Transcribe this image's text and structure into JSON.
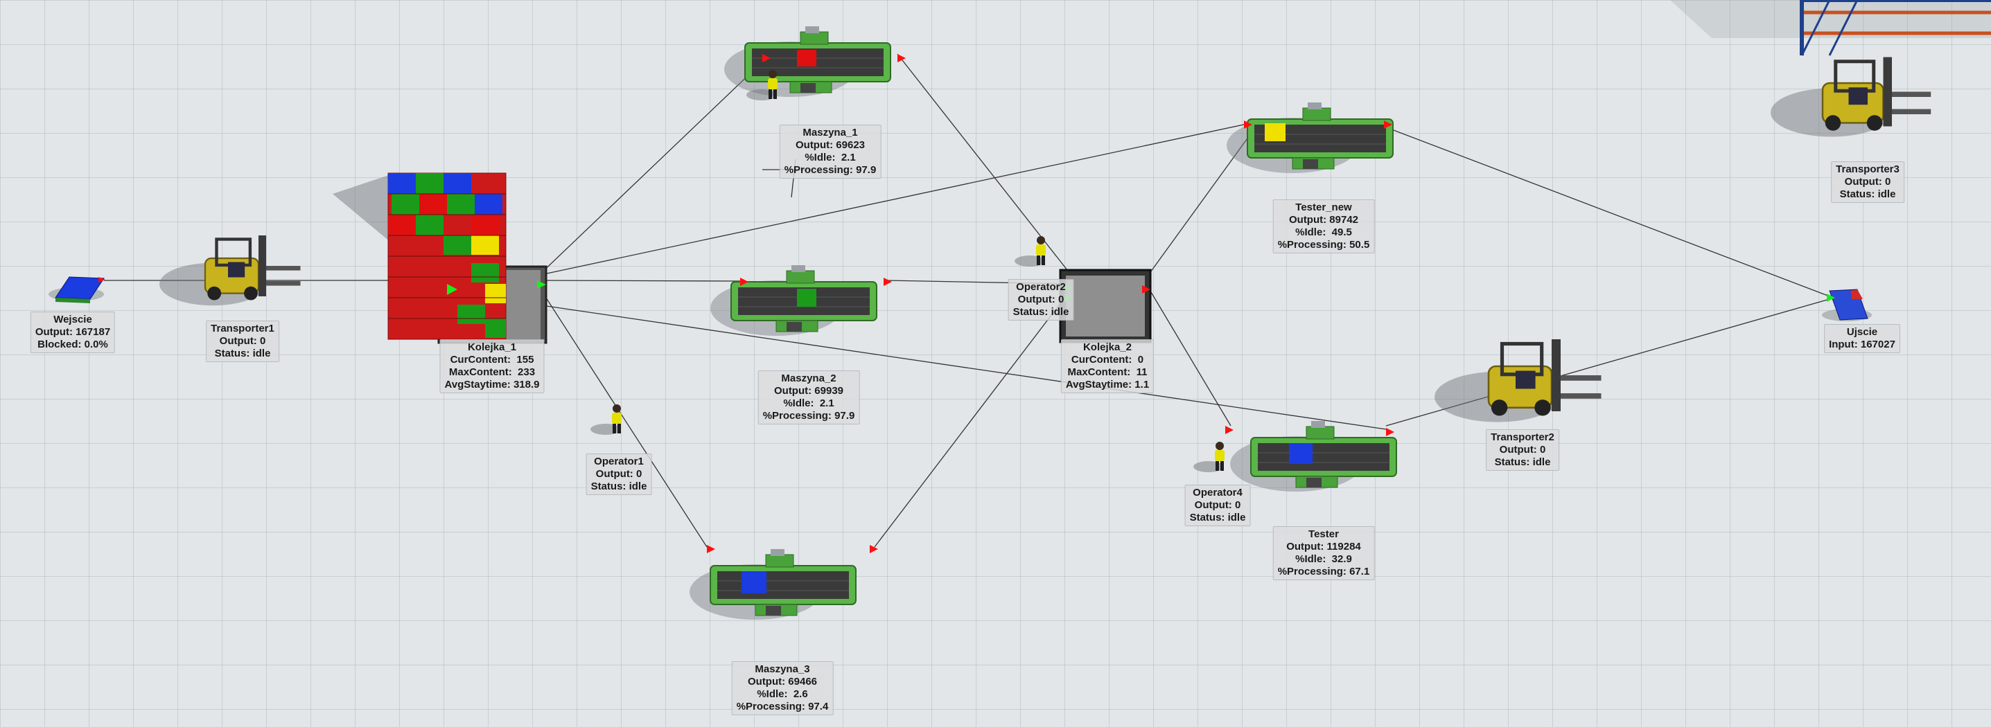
{
  "objects": {
    "wejscie": {
      "name": "Wejscie",
      "lines": [
        "Output: 167187",
        "Blocked: 0.0%"
      ]
    },
    "transporter1": {
      "name": "Transporter1",
      "lines": [
        "Output: 0",
        "Status: idle"
      ]
    },
    "kolejka1": {
      "name": "Kolejka_1",
      "lines": [
        "CurContent:  155",
        "MaxContent:  233",
        "AvgStaytime: 318.9"
      ]
    },
    "operator1": {
      "name": "Operator1",
      "lines": [
        "Output: 0",
        "Status: idle"
      ]
    },
    "maszyna1": {
      "name": "Maszyna_1",
      "lines": [
        "Output: 69623",
        "%Idle:  2.1",
        "%Processing: 97.9"
      ]
    },
    "maszyna2": {
      "name": "Maszyna_2",
      "lines": [
        "Output: 69939",
        "%Idle:  2.1",
        "%Processing: 97.9"
      ]
    },
    "maszyna3": {
      "name": "Maszyna_3",
      "lines": [
        "Output: 69466",
        "%Idle:  2.6",
        "%Processing: 97.4"
      ]
    },
    "operator2": {
      "name": "Operator2",
      "lines": [
        "Output: 0",
        "Status: idle"
      ]
    },
    "kolejka2": {
      "name": "Kolejka_2",
      "lines": [
        "CurContent:  0",
        "MaxContent:  11",
        "AvgStaytime: 1.1"
      ]
    },
    "testerNew": {
      "name": "Tester_new",
      "lines": [
        "Output: 89742",
        "%Idle:  49.5",
        "%Processing: 50.5"
      ]
    },
    "tester": {
      "name": "Tester",
      "lines": [
        "Output: 119284",
        "%Idle:  32.9",
        "%Processing: 67.1"
      ]
    },
    "operator4": {
      "name": "Operator4",
      "lines": [
        "Output: 0",
        "Status: idle"
      ]
    },
    "transporter2": {
      "name": "Transporter2",
      "lines": [
        "Output: 0",
        "Status: idle"
      ]
    },
    "transporter3": {
      "name": "Transporter3",
      "lines": [
        "Output: 0",
        "Status: idle"
      ]
    },
    "ujscie": {
      "name": "Ujscie",
      "lines": [
        "Input: 167027"
      ]
    }
  },
  "colors": {
    "floor": "#e2e6e9",
    "machine_green": "#5bb548",
    "belt": "#3a3a3a",
    "box_red": "#e01010",
    "box_green": "#1a9c1a",
    "box_blue": "#1a3ce0",
    "box_yellow": "#f0e000",
    "forklift_yellow": "#c8b21e",
    "port_red": "#ff1010",
    "connector": "#333333"
  }
}
